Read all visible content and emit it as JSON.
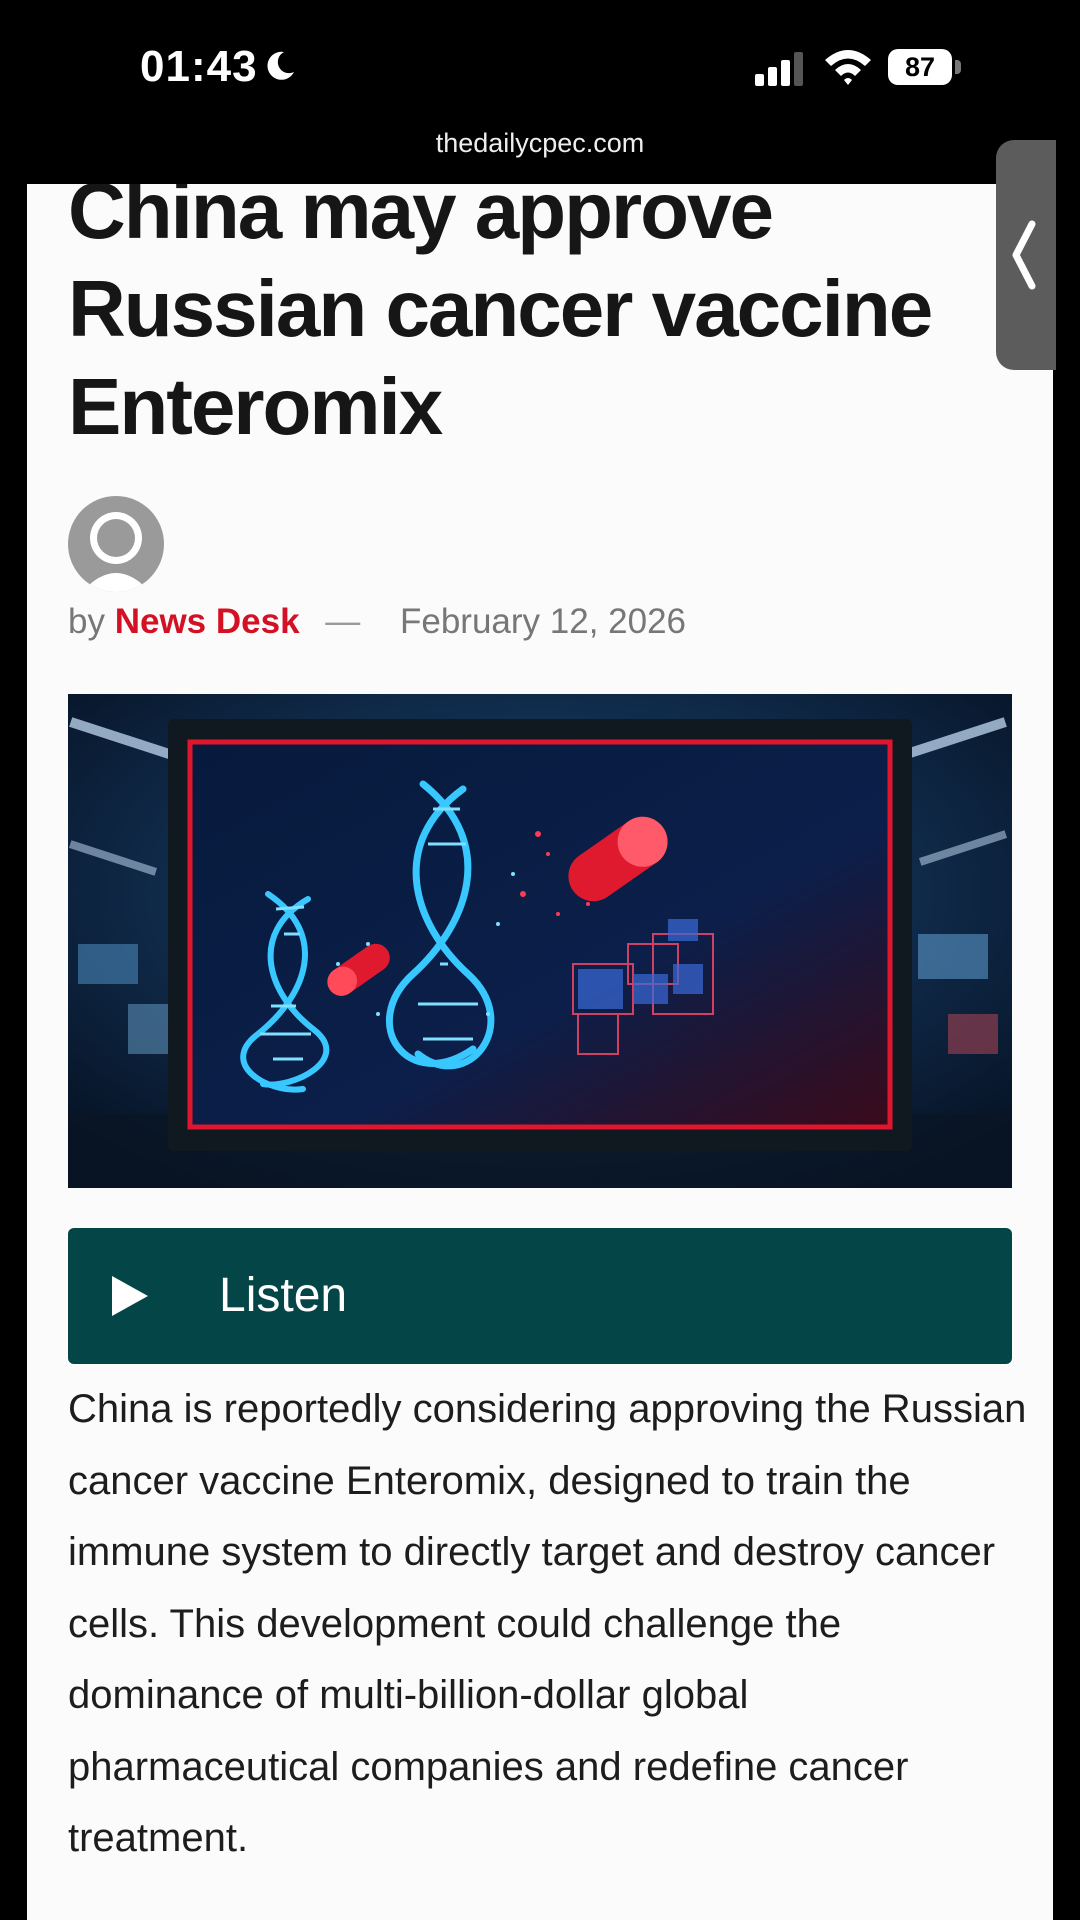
{
  "status_bar": {
    "time": "01:43",
    "battery": "87",
    "icons": [
      "moon-icon",
      "signal-icon",
      "wifi-icon",
      "battery-icon"
    ]
  },
  "browser": {
    "url": "thedailycpec.com"
  },
  "article": {
    "title": "China may approve Russian cancer vaccine Enteromix",
    "byline_prefix": "by",
    "author": "News Desk",
    "separator": "—",
    "date": "February 12, 2026",
    "listen_label": "Listen",
    "body": "China is reportedly considering approving the Russian cancer vaccine Enteromix, designed to train the immune system to directly target and destroy cancer cells. This development could challenge the dominance of multi-billion-dollar global pharmaceutical companies and redefine cancer treatment."
  },
  "colors": {
    "author": "#d31024",
    "listen_bg": "#044548",
    "headline": "#161616",
    "page_bg": "#fafbfa"
  },
  "side_handle": {
    "icon": "chevron-left-icon"
  }
}
